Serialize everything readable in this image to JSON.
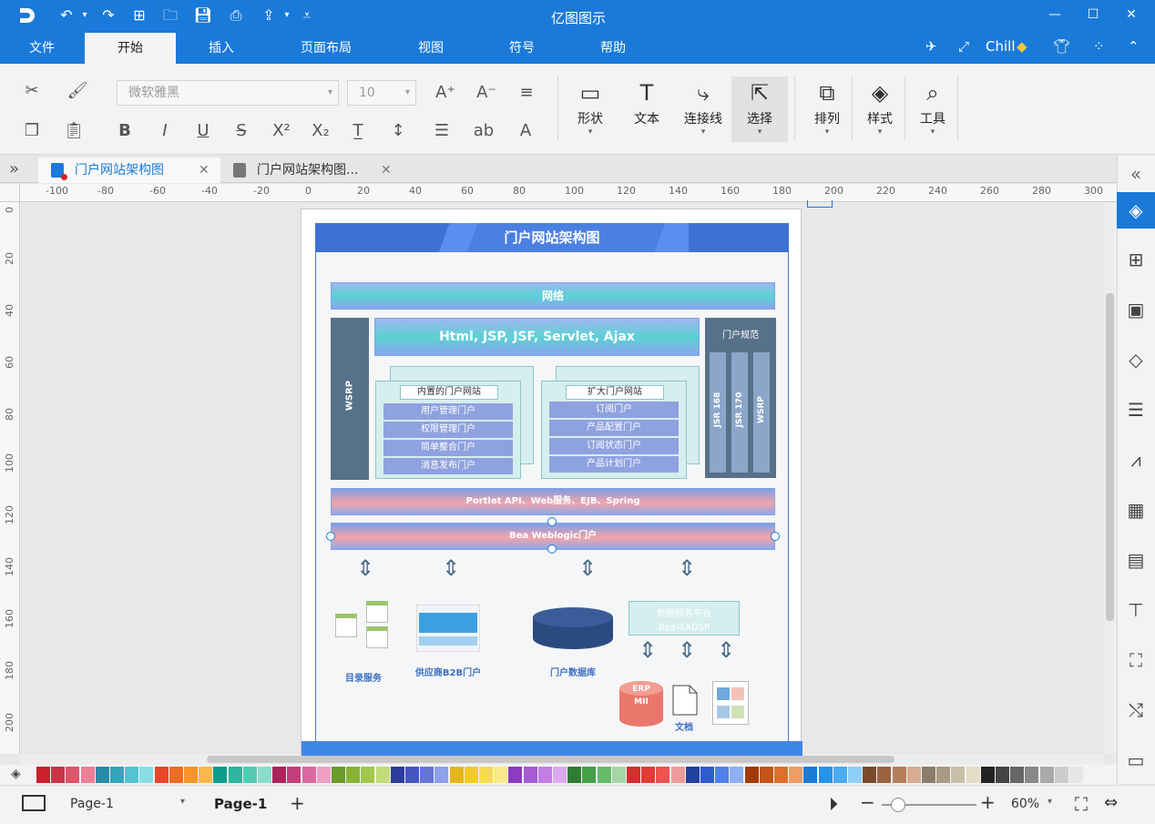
{
  "app": {
    "title": "亿图图示"
  },
  "window": {
    "minimize": "—",
    "maximize": "☐",
    "close": "✕"
  },
  "menu": [
    "文件",
    "开始",
    "插入",
    "页面布局",
    "视图",
    "符号",
    "帮助"
  ],
  "account": {
    "user": "Chill"
  },
  "ribbon": {
    "font_name": "微软雅黑",
    "font_size": "10",
    "big_buttons": [
      {
        "label": "形状"
      },
      {
        "label": "文本"
      },
      {
        "label": "连接线"
      },
      {
        "label": "选择"
      },
      {
        "label": "排列"
      },
      {
        "label": "样式"
      },
      {
        "label": "工具"
      }
    ]
  },
  "tabs": [
    {
      "label": "门户网站架构图",
      "active": true
    },
    {
      "label": "门户网站架构图...",
      "active": false
    }
  ],
  "ruler": {
    "h": [
      "-100",
      "-80",
      "-60",
      "-40",
      "-20",
      "0",
      "20",
      "40",
      "60",
      "80",
      "100",
      "120",
      "140",
      "160",
      "180",
      "200",
      "220",
      "240",
      "260",
      "280",
      "300"
    ],
    "v": [
      "0",
      "20",
      "40",
      "60",
      "80",
      "100",
      "120",
      "140",
      "160",
      "180",
      "200"
    ]
  },
  "diagram": {
    "title": "门户网站架构图",
    "network": "网络",
    "tech": "Html, JSP, JSF, Servlet, Ajax",
    "wsrp_left": "WSRP",
    "portal_spec": "门户规范",
    "spec_cols": [
      "JSR 168",
      "JSR 170",
      "WSRP"
    ],
    "internal_portal": {
      "title": "内置的门户网站",
      "items": [
        "用户管理门户",
        "权限管理门户",
        "简单整合门户",
        "消息发布门户"
      ]
    },
    "extended_portal": {
      "title": "扩大门户网站",
      "items": [
        "订阅门户",
        "产品配置门户",
        "订阅状态门户",
        "产品计划门户"
      ]
    },
    "portlet": "Portlet API、Web服务、EJB、Spring",
    "weblogic": "Bea Weblogic门户",
    "bottom": {
      "directory": "目录服务",
      "b2b": "供应商B2B门户",
      "database": "门户数据库",
      "data_platform": [
        "数据服务平台",
        "Bea以ADSP"
      ],
      "erp": [
        "ERP",
        "MII"
      ],
      "docs": "文档"
    }
  },
  "palette": [
    "#c9202c",
    "#c93446",
    "#e0546a",
    "#ee7f95",
    "#2a8aa8",
    "#31a6bb",
    "#54c3d2",
    "#88dde6",
    "#e8472b",
    "#f26b24",
    "#f69523",
    "#f9b84b",
    "#0c9e8a",
    "#2db59e",
    "#56c9b3",
    "#89dccb",
    "#a8245c",
    "#c33e7c",
    "#dd68a1",
    "#eea0c6",
    "#6a9a2a",
    "#86b236",
    "#a1c84b",
    "#c3dc7a",
    "#2c3c9c",
    "#4556bd",
    "#6475d6",
    "#8ea0ea",
    "#e6b51c",
    "#f2cb24",
    "#f6dc4a",
    "#f9e989",
    "#8a3bbf",
    "#a75bd3",
    "#c27ee2",
    "#dba9ef",
    "#2e7d32",
    "#43a047",
    "#66bb6a",
    "#a5d6a7",
    "#d32f2f",
    "#e53935",
    "#ef5350",
    "#ef9a9a",
    "#1e40a0",
    "#2f5bd0",
    "#5080e8",
    "#8db0f5",
    "#a23a07",
    "#c2551a",
    "#e06e2a",
    "#f19a62",
    "#1a7ad9",
    "#2793e6",
    "#48acef",
    "#8cd0f8",
    "#7a4b2a",
    "#9a6240",
    "#b47e5c",
    "#d6ad8e",
    "#8a7d6a",
    "#a89a84",
    "#c9bea8",
    "#e6ddc8",
    "#222222",
    "#444444",
    "#666666",
    "#888888",
    "#aaaaaa",
    "#cccccc",
    "#e6e6e6"
  ],
  "status": {
    "page_selector": "Page-1",
    "page_tab": "Page-1",
    "add": "+",
    "zoom": "60%"
  }
}
